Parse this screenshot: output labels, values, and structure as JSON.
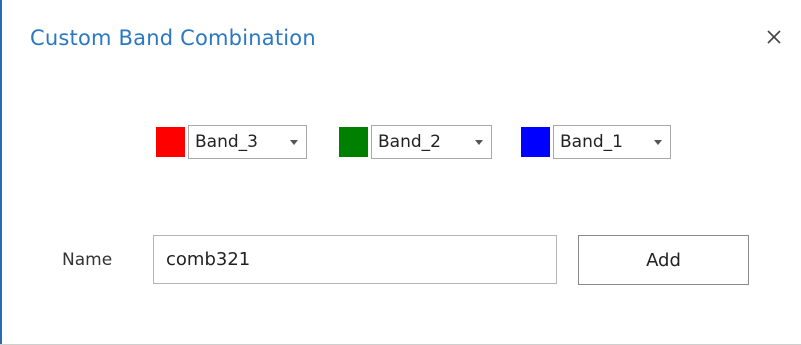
{
  "dialog": {
    "title": "Custom Band Combination",
    "close_icon": "close-icon"
  },
  "bands": [
    {
      "color": "#ff0000",
      "selected": "Band_3"
    },
    {
      "color": "#008000",
      "selected": "Band_2"
    },
    {
      "color": "#0000ff",
      "selected": "Band_1"
    }
  ],
  "name": {
    "label": "Name",
    "value": "comb321"
  },
  "add_button": {
    "label": "Add"
  }
}
